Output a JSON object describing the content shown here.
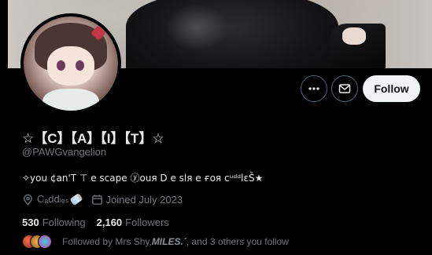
{
  "profile": {
    "display_name": "☆【C】【A】【I】【T】☆",
    "handle": "@PAWGvangelion",
    "bio": "✧you ¢an'T ⊤ e ѕcape ⓨouя D e ѕlя e ғoя cᵘᵈᵈlɛŠ★",
    "location": "Cₐddₗₑₛ",
    "joined": "Joined July 2023",
    "following_count": "530",
    "following_label": "Following",
    "followers_count": "2,160",
    "followers_label": "Followers",
    "followed_by_prefix": "Followed by Mrs Shy, ",
    "followed_by_emph": "MILES.´",
    "followed_by_suffix": ", and 3 others you follow"
  },
  "actions": {
    "more_icon": "more-dots-icon",
    "message_icon": "envelope-icon",
    "follow_label": "Follow"
  },
  "icons": {
    "location": "map-pin-icon",
    "joined": "calendar-icon"
  },
  "colors": {
    "background": "#000000",
    "primary_text": "#e7e9ea",
    "secondary_text": "#71767b",
    "follow_button_bg": "#eff3f4",
    "follow_button_text": "#0f1419",
    "border": "#536471"
  }
}
